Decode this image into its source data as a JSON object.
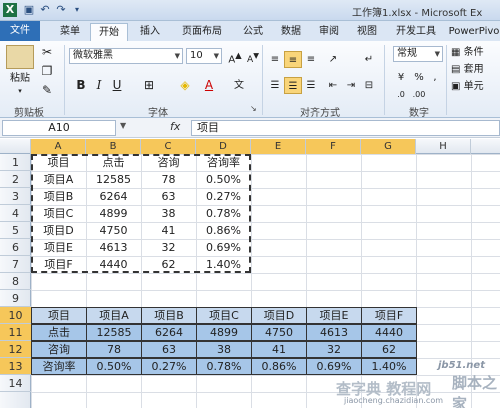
{
  "window": {
    "title": "工作簿1.xlsx - Microsoft Ex"
  },
  "quick_access": [
    "save-icon",
    "undo-icon",
    "redo-icon"
  ],
  "tabs": [
    "文件",
    "菜单",
    "开始",
    "插入",
    "页面布局",
    "公式",
    "数据",
    "审阅",
    "视图",
    "开发工具",
    "PowerPivo"
  ],
  "ribbon": {
    "paste_label": "粘贴",
    "font_name": "微软雅黑",
    "font_size": "10",
    "number_format": "常规",
    "groups": [
      "剪贴板",
      "字体",
      "对齐方式",
      "数字"
    ],
    "conditional": "条件",
    "table_format": "套用",
    "cell_style": "单元"
  },
  "formula_bar": {
    "name_box": "A10",
    "fx": "fx",
    "value": "项目"
  },
  "columns": [
    "A",
    "B",
    "C",
    "D",
    "E",
    "F",
    "G",
    "H"
  ],
  "rows": [
    "1",
    "2",
    "3",
    "4",
    "5",
    "6",
    "7",
    "8",
    "9",
    "10",
    "11",
    "12",
    "13",
    "14"
  ],
  "source_table": {
    "header": [
      "项目",
      "点击",
      "咨询",
      "咨询率"
    ],
    "rows": [
      [
        "项目A",
        "12585",
        "78",
        "0.50%"
      ],
      [
        "项目B",
        "6264",
        "63",
        "0.27%"
      ],
      [
        "项目C",
        "4899",
        "38",
        "0.78%"
      ],
      [
        "项目D",
        "4750",
        "41",
        "0.86%"
      ],
      [
        "项目E",
        "4613",
        "32",
        "0.69%"
      ],
      [
        "项目F",
        "4440",
        "62",
        "1.40%"
      ]
    ]
  },
  "transposed_table": {
    "rows": [
      [
        "项目",
        "项目A",
        "项目B",
        "项目C",
        "项目D",
        "项目E",
        "项目F"
      ],
      [
        "点击",
        "12585",
        "6264",
        "4899",
        "4750",
        "4613",
        "4440"
      ],
      [
        "咨询",
        "78",
        "63",
        "38",
        "41",
        "32",
        "62"
      ],
      [
        "咨询率",
        "0.50%",
        "0.27%",
        "0.78%",
        "0.86%",
        "0.69%",
        "1.40%"
      ]
    ]
  },
  "watermarks": {
    "site": "jb51.net",
    "text1": "脚本之家",
    "text2": "查字典 教程网",
    "url": "jiaocheng.chazidian.com"
  }
}
